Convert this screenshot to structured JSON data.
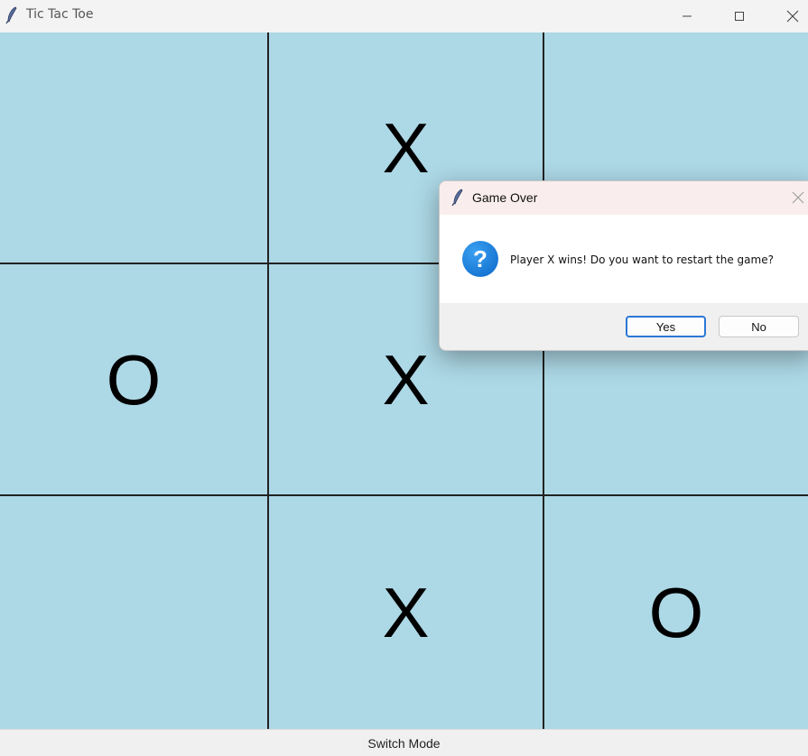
{
  "window": {
    "title": "Tic Tac Toe",
    "controls": {
      "minimize": "minimize-icon",
      "maximize": "maximize-icon",
      "close": "close-icon"
    }
  },
  "board": {
    "cells": [
      "",
      "X",
      "",
      "O",
      "X",
      "",
      "",
      "X",
      "O"
    ],
    "cell_color": "#add8e6",
    "grid_line_color": "#222222"
  },
  "statusbar": {
    "switch_mode_label": "Switch Mode"
  },
  "dialog": {
    "title": "Game Over",
    "icon": "question-icon",
    "icon_glyph": "?",
    "message": "Player X wins! Do you want to restart the game?",
    "yes_label": "Yes",
    "no_label": "No",
    "accent_color": "#2b78d6"
  }
}
